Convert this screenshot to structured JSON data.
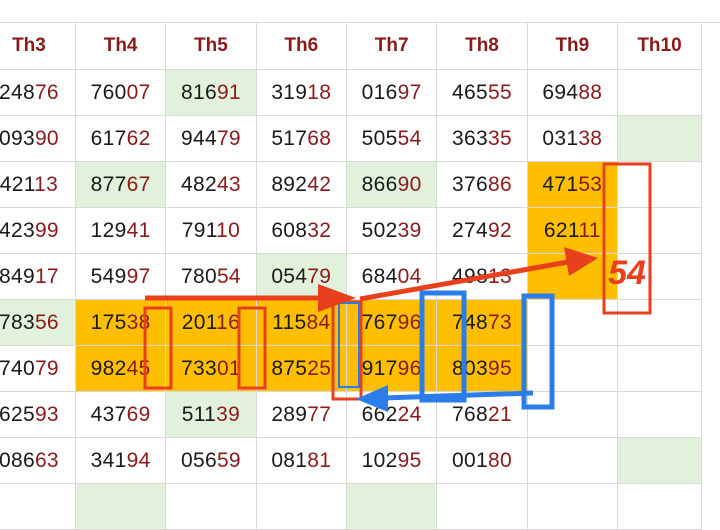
{
  "headers": [
    "Th3",
    "Th4",
    "Th5",
    "Th6",
    "Th7",
    "Th8",
    "Th9",
    "Th10"
  ],
  "rows": [
    [
      {
        "p": "248",
        "s": "76",
        "bg": ""
      },
      {
        "p": "760",
        "s": "07",
        "bg": ""
      },
      {
        "p": "816",
        "s": "91",
        "bg": "green"
      },
      {
        "p": "319",
        "s": "18",
        "bg": ""
      },
      {
        "p": "016",
        "s": "97",
        "bg": ""
      },
      {
        "p": "465",
        "s": "55",
        "bg": ""
      },
      {
        "p": "694",
        "s": "88",
        "bg": ""
      },
      {
        "p": "",
        "s": "",
        "bg": ""
      }
    ],
    [
      {
        "p": "093",
        "s": "90",
        "bg": ""
      },
      {
        "p": "617",
        "s": "62",
        "bg": ""
      },
      {
        "p": "944",
        "s": "79",
        "bg": ""
      },
      {
        "p": "517",
        "s": "68",
        "bg": ""
      },
      {
        "p": "505",
        "s": "54",
        "bg": ""
      },
      {
        "p": "363",
        "s": "35",
        "bg": ""
      },
      {
        "p": "031",
        "s": "38",
        "bg": ""
      },
      {
        "p": "",
        "s": "",
        "bg": "green"
      }
    ],
    [
      {
        "p": "421",
        "s": "13",
        "bg": ""
      },
      {
        "p": "877",
        "s": "67",
        "bg": "green"
      },
      {
        "p": "482",
        "s": "43",
        "bg": ""
      },
      {
        "p": "892",
        "s": "42",
        "bg": ""
      },
      {
        "p": "866",
        "s": "90",
        "bg": "green"
      },
      {
        "p": "376",
        "s": "86",
        "bg": ""
      },
      {
        "p": "471",
        "s": "53",
        "bg": "gold"
      },
      {
        "p": "",
        "s": "",
        "bg": ""
      }
    ],
    [
      {
        "p": "423",
        "s": "99",
        "bg": ""
      },
      {
        "p": "129",
        "s": "41",
        "bg": ""
      },
      {
        "p": "791",
        "s": "10",
        "bg": ""
      },
      {
        "p": "608",
        "s": "32",
        "bg": ""
      },
      {
        "p": "502",
        "s": "39",
        "bg": ""
      },
      {
        "p": "274",
        "s": "92",
        "bg": ""
      },
      {
        "p": "621",
        "s": "11",
        "bg": "gold"
      },
      {
        "p": "",
        "s": "",
        "bg": ""
      }
    ],
    [
      {
        "p": "849",
        "s": "17",
        "bg": ""
      },
      {
        "p": "549",
        "s": "97",
        "bg": ""
      },
      {
        "p": "780",
        "s": "54",
        "bg": ""
      },
      {
        "p": "054",
        "s": "79",
        "bg": "green"
      },
      {
        "p": "684",
        "s": "04",
        "bg": ""
      },
      {
        "p": "498",
        "s": "13",
        "bg": ""
      },
      {
        "p": "",
        "s": "",
        "bg": "gold"
      },
      {
        "p": "",
        "s": "",
        "bg": ""
      }
    ],
    [
      {
        "p": "783",
        "s": "56",
        "bg": "green"
      },
      {
        "p": "175",
        "s": "38",
        "bg": "gold"
      },
      {
        "p": "201",
        "s": "16",
        "bg": "gold"
      },
      {
        "p": "115",
        "s": "84",
        "bg": "gold"
      },
      {
        "p": "767",
        "s": "96",
        "bg": "gold"
      },
      {
        "p": "748",
        "s": "73",
        "bg": "gold"
      },
      {
        "p": "",
        "s": "",
        "bg": ""
      },
      {
        "p": "",
        "s": "",
        "bg": ""
      }
    ],
    [
      {
        "p": "740",
        "s": "79",
        "bg": ""
      },
      {
        "p": "982",
        "s": "45",
        "bg": "gold"
      },
      {
        "p": "733",
        "s": "01",
        "bg": "gold"
      },
      {
        "p": "875",
        "s": "25",
        "bg": "gold"
      },
      {
        "p": "917",
        "s": "96",
        "bg": "gold"
      },
      {
        "p": "803",
        "s": "95",
        "bg": "gold"
      },
      {
        "p": "",
        "s": "",
        "bg": ""
      },
      {
        "p": "",
        "s": "",
        "bg": ""
      }
    ],
    [
      {
        "p": "625",
        "s": "93",
        "bg": ""
      },
      {
        "p": "437",
        "s": "69",
        "bg": ""
      },
      {
        "p": "511",
        "s": "39",
        "bg": "green"
      },
      {
        "p": "289",
        "s": "77",
        "bg": ""
      },
      {
        "p": "662",
        "s": "24",
        "bg": ""
      },
      {
        "p": "768",
        "s": "21",
        "bg": ""
      },
      {
        "p": "",
        "s": "",
        "bg": ""
      },
      {
        "p": "",
        "s": "",
        "bg": ""
      }
    ],
    [
      {
        "p": "086",
        "s": "63",
        "bg": ""
      },
      {
        "p": "341",
        "s": "94",
        "bg": ""
      },
      {
        "p": "056",
        "s": "59",
        "bg": ""
      },
      {
        "p": "081",
        "s": "81",
        "bg": ""
      },
      {
        "p": "102",
        "s": "95",
        "bg": ""
      },
      {
        "p": "001",
        "s": "80",
        "bg": ""
      },
      {
        "p": "",
        "s": "",
        "bg": ""
      },
      {
        "p": "",
        "s": "",
        "bg": "green"
      }
    ],
    [
      {
        "p": "",
        "s": "",
        "bg": ""
      },
      {
        "p": "",
        "s": "",
        "bg": "green"
      },
      {
        "p": "",
        "s": "",
        "bg": ""
      },
      {
        "p": "",
        "s": "",
        "bg": ""
      },
      {
        "p": "",
        "s": "",
        "bg": "green"
      },
      {
        "p": "",
        "s": "",
        "bg": ""
      },
      {
        "p": "",
        "s": "",
        "bg": ""
      },
      {
        "p": "",
        "s": "",
        "bg": ""
      }
    ]
  ],
  "annotation": {
    "text": "54",
    "colors": {
      "red": "#e8401c",
      "blue": "#2b7de9",
      "gold": "#ffbf00",
      "green": "#e2f1dc",
      "maroon": "#8b1a1a"
    }
  }
}
